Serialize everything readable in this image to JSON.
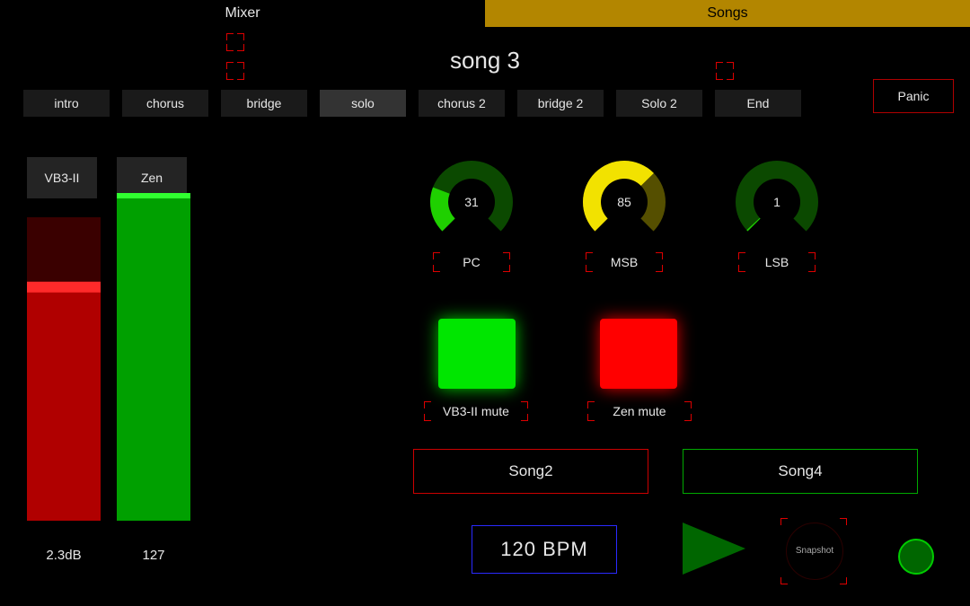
{
  "tabs": {
    "mixer": "Mixer",
    "songs": "Songs"
  },
  "song_title": "song 3",
  "sections": [
    "intro",
    "chorus",
    "bridge",
    "solo",
    "chorus 2",
    "bridge 2",
    "Solo 2",
    "End"
  ],
  "active_section_index": 3,
  "panic": "Panic",
  "channels": [
    {
      "name": "VB3-II",
      "value_label": "2.3dB",
      "fill_ratio": 0.77,
      "peak_ratio": 0.77,
      "color": "red"
    },
    {
      "name": "Zen",
      "value_label": "127",
      "fill_ratio": 1.0,
      "peak_ratio": 1.0,
      "color": "green"
    }
  ],
  "knobs": [
    {
      "label": "PC",
      "value": 31,
      "max": 127,
      "color": "#1fd000"
    },
    {
      "label": "MSB",
      "value": 85,
      "max": 127,
      "color": "#f2e200"
    },
    {
      "label": "LSB",
      "value": 1,
      "max": 127,
      "color": "#1fd000"
    }
  ],
  "mutes": [
    {
      "label": "VB3-II mute",
      "state": "on",
      "color": "green"
    },
    {
      "label": "Zen mute",
      "state": "off",
      "color": "red"
    }
  ],
  "song_nav": {
    "prev": "Song2",
    "next": "Song4"
  },
  "bpm_text": "120  BPM",
  "bpm_value": 120,
  "snapshot": "Snapshot"
}
